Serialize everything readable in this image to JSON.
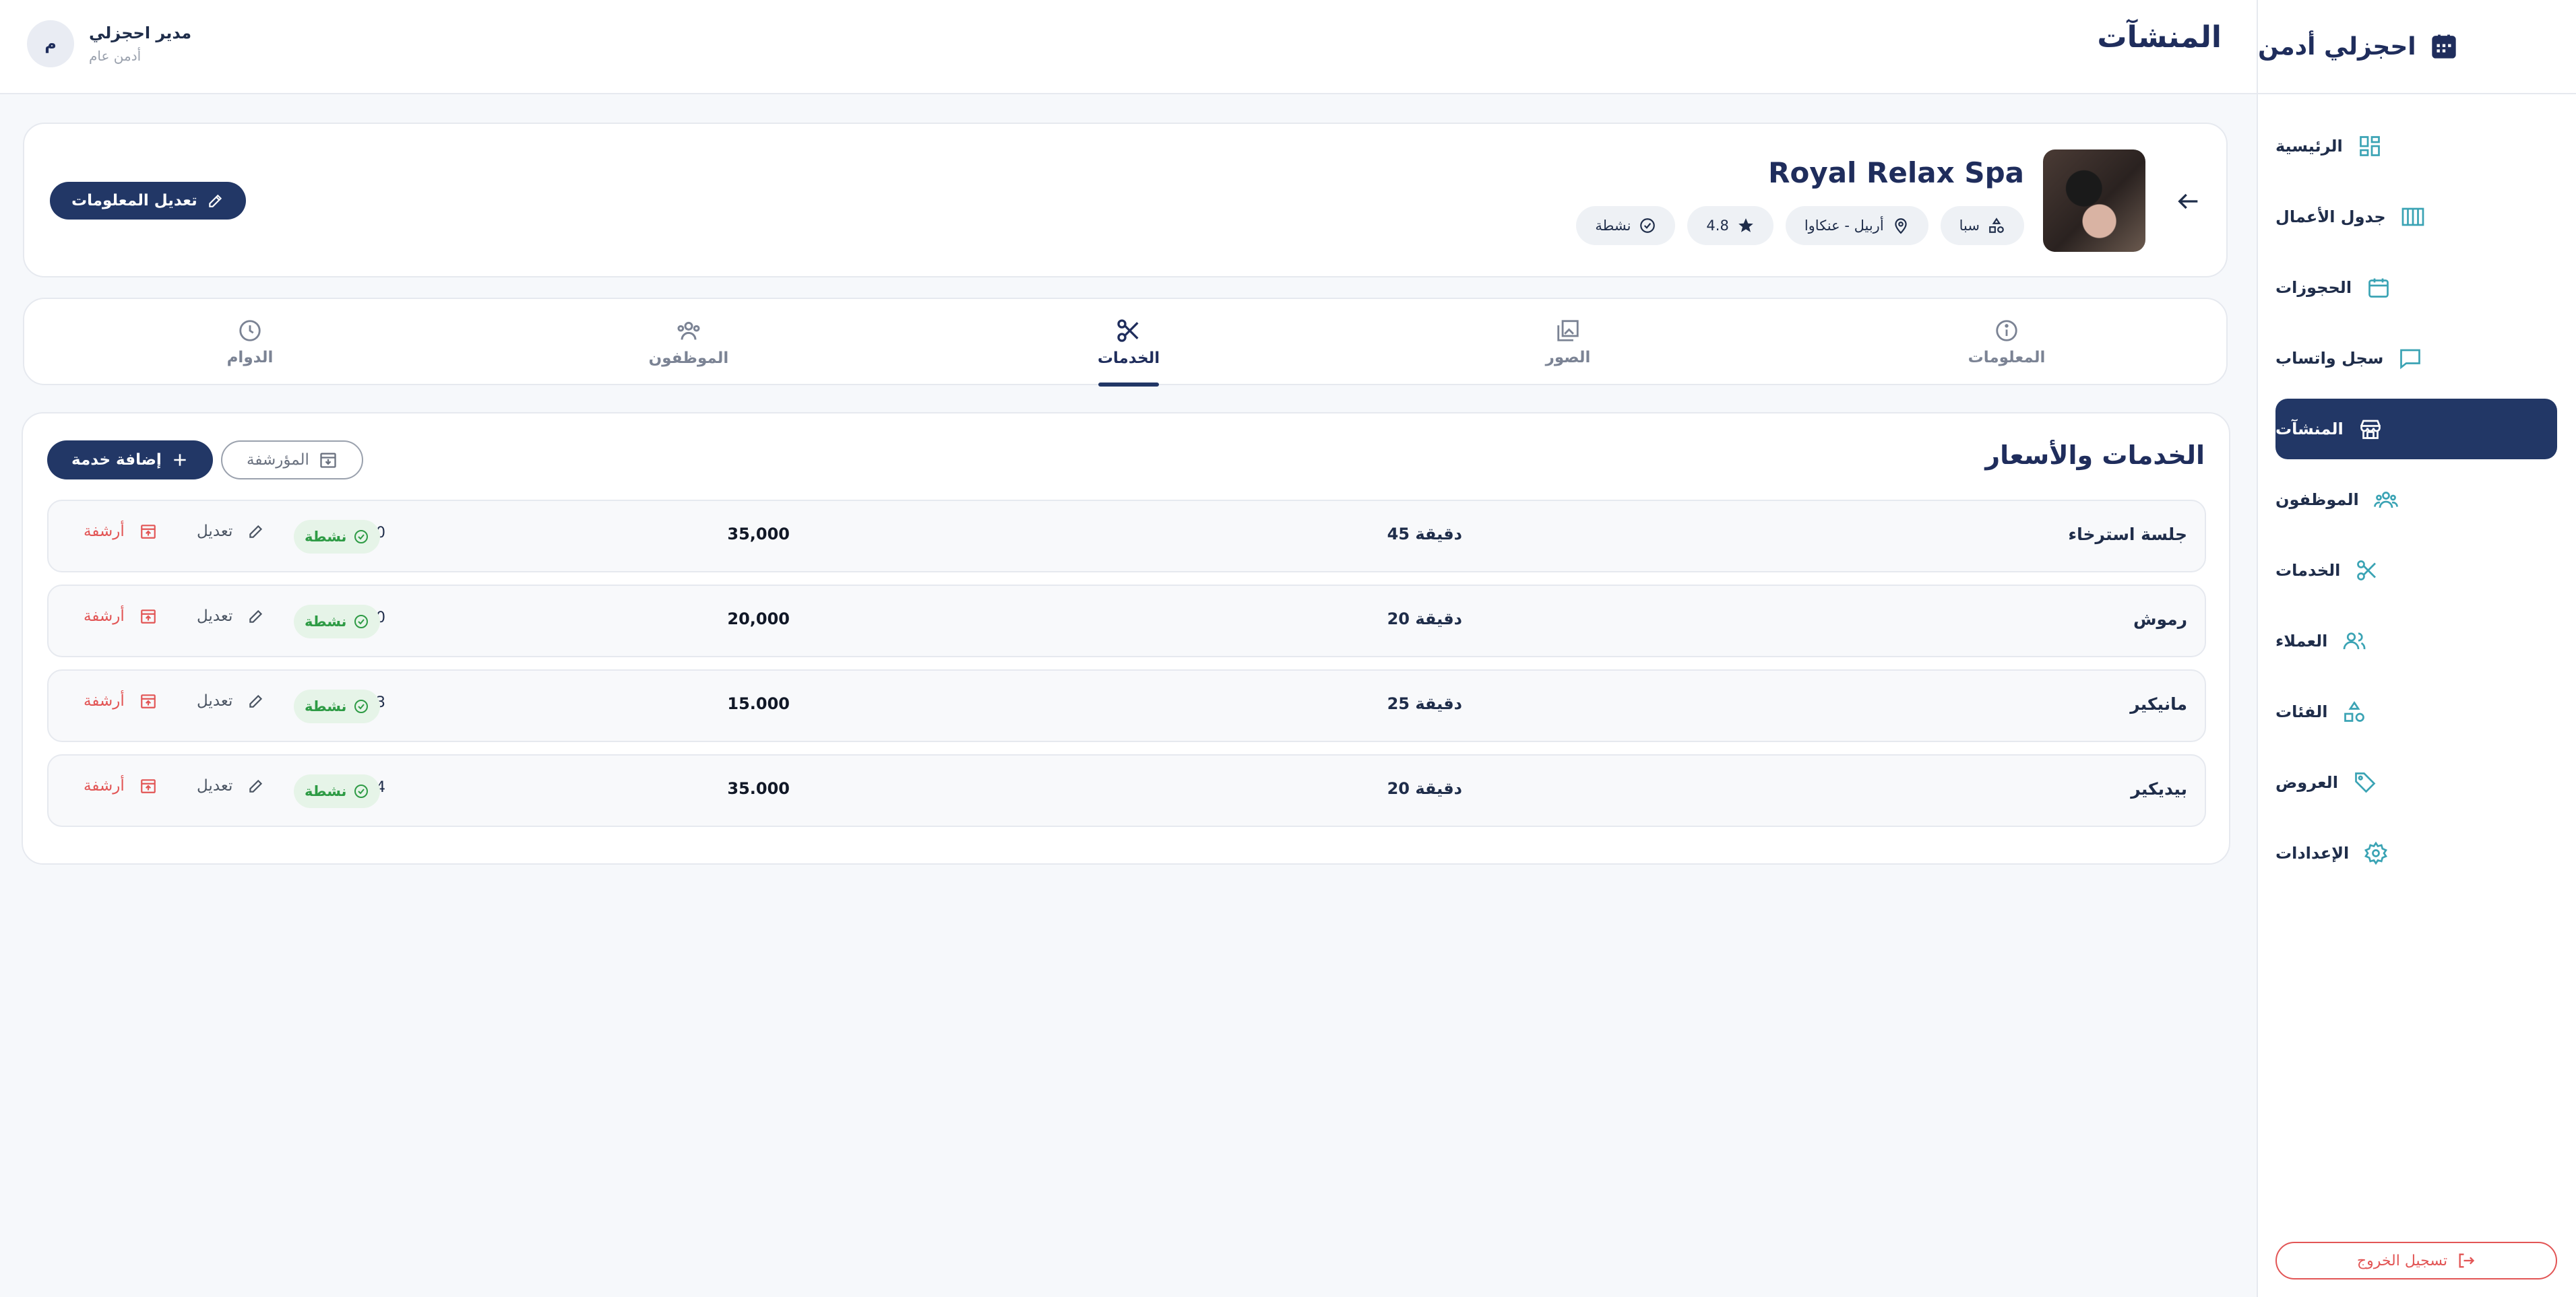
{
  "app": {
    "brand": "احجزلي أدمن"
  },
  "header": {
    "title": "المنشآت",
    "user_name": "مدير احجزلي",
    "user_role": "أدمن عام",
    "avatar_initial": "م"
  },
  "sidebar": {
    "items": [
      {
        "label": "الرئيسية",
        "icon": "dashboard-icon"
      },
      {
        "label": "جدول الأعمال",
        "icon": "schedule-icon"
      },
      {
        "label": "الحجوزات",
        "icon": "calendar-icon"
      },
      {
        "label": "سجل واتساب",
        "icon": "chat-icon"
      },
      {
        "label": "المنشآت",
        "icon": "store-icon",
        "active": true
      },
      {
        "label": "الموظفون",
        "icon": "users-icon"
      },
      {
        "label": "الخدمات",
        "icon": "scissors-icon"
      },
      {
        "label": "العملاء",
        "icon": "customers-icon"
      },
      {
        "label": "الفئات",
        "icon": "categories-icon"
      },
      {
        "label": "العروض",
        "icon": "tag-icon"
      },
      {
        "label": "الإعدادات",
        "icon": "gear-icon"
      }
    ],
    "logout": "تسجيل الخروج"
  },
  "facility": {
    "name": "Royal Relax Spa",
    "category": "سبا",
    "location": "أربيل - عنكاوا",
    "rating": "4.8",
    "status": "نشطة",
    "edit_label": "تعديل المعلومات"
  },
  "tabs": [
    {
      "label": "المعلومات",
      "icon": "info-icon"
    },
    {
      "label": "الصور",
      "icon": "images-icon"
    },
    {
      "label": "الخدمات",
      "icon": "scissors-icon",
      "active": true
    },
    {
      "label": "الموظفون",
      "icon": "staff-icon"
    },
    {
      "label": "الدوام",
      "icon": "clock-icon"
    }
  ],
  "services": {
    "title": "الخدمات والأسعار",
    "add_label": "إضافة خدمة",
    "archived_label": "المؤرشفة",
    "edit_label": "تعديل",
    "archive_label": "أرشفة",
    "rows": [
      {
        "name": "جلسة استرخاء",
        "duration": "45 دقيقة",
        "price": "35,000",
        "status": "نشطة",
        "count": "0"
      },
      {
        "name": "رموش",
        "duration": "20 دقيقة",
        "price": "20,000",
        "status": "نشطة",
        "count": "0"
      },
      {
        "name": "مانيكير",
        "duration": "25 دقيقة",
        "price": "15.000",
        "status": "نشطة",
        "count": "3"
      },
      {
        "name": "بيديكير",
        "duration": "20 دقيقة",
        "price": "35.000",
        "status": "نشطة",
        "count": "4"
      }
    ]
  },
  "colors": {
    "primary": "#223766",
    "danger": "#e25555",
    "success": "#2e9b45",
    "background": "#f6f8fb"
  }
}
